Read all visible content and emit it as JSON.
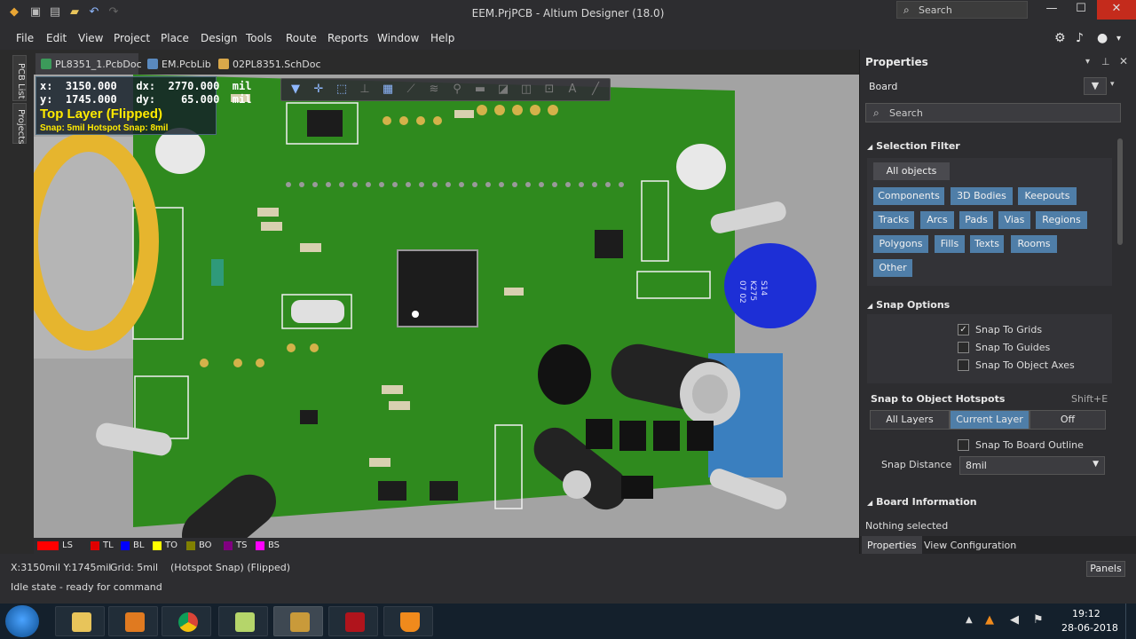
{
  "window": {
    "title": "EEM.PrjPCB - Altium Designer (18.0)",
    "search_placeholder": "Search"
  },
  "menu": [
    "File",
    "Edit",
    "View",
    "Project",
    "Place",
    "Design",
    "Tools",
    "Route",
    "Reports",
    "Window",
    "Help"
  ],
  "left_panels": [
    "PCB List",
    "Projects"
  ],
  "doc_tabs": [
    "PL8351_1.PcbDoc",
    "EM.PcbLib",
    "02PL8351.SchDoc"
  ],
  "coord_overlay": {
    "line1": "x:  3150.000   dx:  2770.000  mil",
    "line2": "y:  1745.000   dy:    65.000  mil",
    "layer": "Top Layer (Flipped)",
    "snap": "Snap: 5mil Hotspot Snap: 8mil"
  },
  "layers": [
    {
      "name": "LS",
      "color": "#ff0000"
    },
    {
      "name": "TL",
      "color": "#e00000"
    },
    {
      "name": "BL",
      "color": "#0000ff"
    },
    {
      "name": "TO",
      "color": "#ffff00"
    },
    {
      "name": "BO",
      "color": "#808000"
    },
    {
      "name": "TS",
      "color": "#800080"
    },
    {
      "name": "BS",
      "color": "#ff00ff"
    }
  ],
  "properties": {
    "title": "Properties",
    "object": "Board",
    "search_placeholder": "Search",
    "selection_filter": {
      "header": "Selection Filter",
      "all": "All objects",
      "buttons": [
        "Components",
        "3D Bodies",
        "Keepouts",
        "Tracks",
        "Arcs",
        "Pads",
        "Vias",
        "Regions",
        "Polygons",
        "Fills",
        "Texts",
        "Rooms",
        "Other"
      ]
    },
    "snap_options": {
      "header": "Snap Options",
      "checks": [
        {
          "label": "Snap To Grids",
          "checked": "✓"
        },
        {
          "label": "Snap To Guides",
          "checked": ""
        },
        {
          "label": "Snap To Object Axes",
          "checked": ""
        }
      ],
      "hotspots_label": "Snap to Object Hotspots",
      "hotspots_shortcut": "Shift+E",
      "segments": [
        "All Layers",
        "Current Layer",
        "Off"
      ],
      "board_outline": "Snap To Board Outline",
      "distance_label": "Snap Distance",
      "distance_value": "8mil"
    },
    "board_info": {
      "header": "Board Information",
      "text": "Nothing selected"
    },
    "bottom_tabs": [
      "Properties",
      "View Configuration"
    ]
  },
  "status": {
    "coords": "X:3150mil Y:1745mil",
    "grid": "Grid: 5mil",
    "mode": "(Hotspot Snap) (Flipped)",
    "state": "Idle state - ready for command",
    "panels_button": "Panels"
  },
  "taskbar": {
    "time": "19:12",
    "date": "28-06-2018"
  },
  "board_labels": {
    "cap_text1": "S14",
    "cap_text2": "K275",
    "cap_text3": "07 02"
  }
}
